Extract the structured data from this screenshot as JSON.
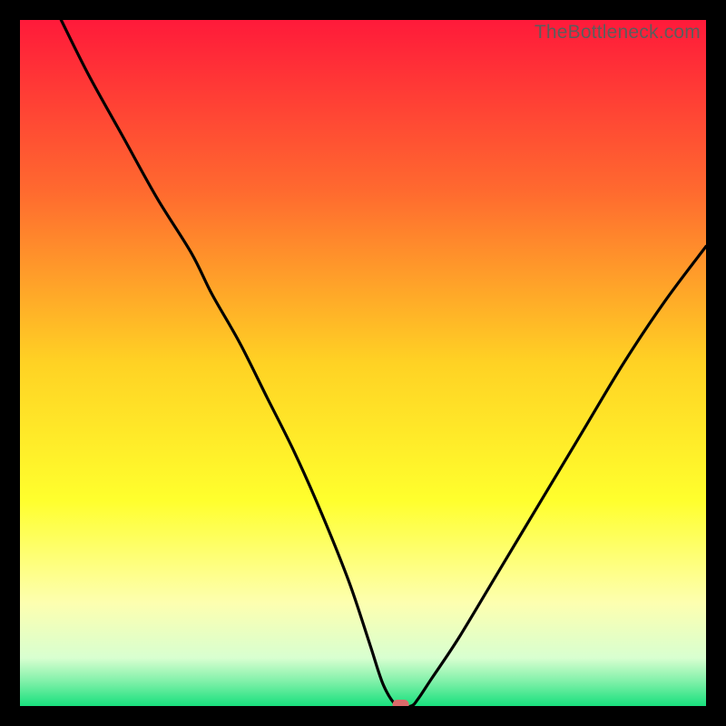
{
  "watermark": "TheBottleneck.com",
  "chart_data": {
    "type": "line",
    "title": "",
    "xlabel": "",
    "ylabel": "",
    "xlim": [
      0,
      100
    ],
    "ylim": [
      0,
      100
    ],
    "grid": false,
    "legend": false,
    "marker": {
      "x": 55.5,
      "y": 0,
      "color": "#db6a6a"
    },
    "gradient_stops": [
      {
        "offset": 0.0,
        "color": "#ff1a3a"
      },
      {
        "offset": 0.25,
        "color": "#ff6a2f"
      },
      {
        "offset": 0.5,
        "color": "#ffd224"
      },
      {
        "offset": 0.7,
        "color": "#ffff2d"
      },
      {
        "offset": 0.85,
        "color": "#fdffb0"
      },
      {
        "offset": 0.93,
        "color": "#d8ffd0"
      },
      {
        "offset": 0.965,
        "color": "#7ef0a8"
      },
      {
        "offset": 1.0,
        "color": "#18e07d"
      }
    ],
    "series": [
      {
        "name": "curve",
        "x": [
          6,
          10,
          15,
          20,
          25,
          28,
          32,
          36,
          40,
          44,
          48,
          51,
          53,
          55,
          57,
          58,
          60,
          64,
          70,
          76,
          82,
          88,
          94,
          100
        ],
        "y": [
          100,
          92,
          83,
          74,
          66,
          60,
          53,
          45,
          37,
          28,
          18,
          9,
          3,
          0,
          0,
          1,
          4,
          10,
          20,
          30,
          40,
          50,
          59,
          67
        ]
      }
    ]
  }
}
